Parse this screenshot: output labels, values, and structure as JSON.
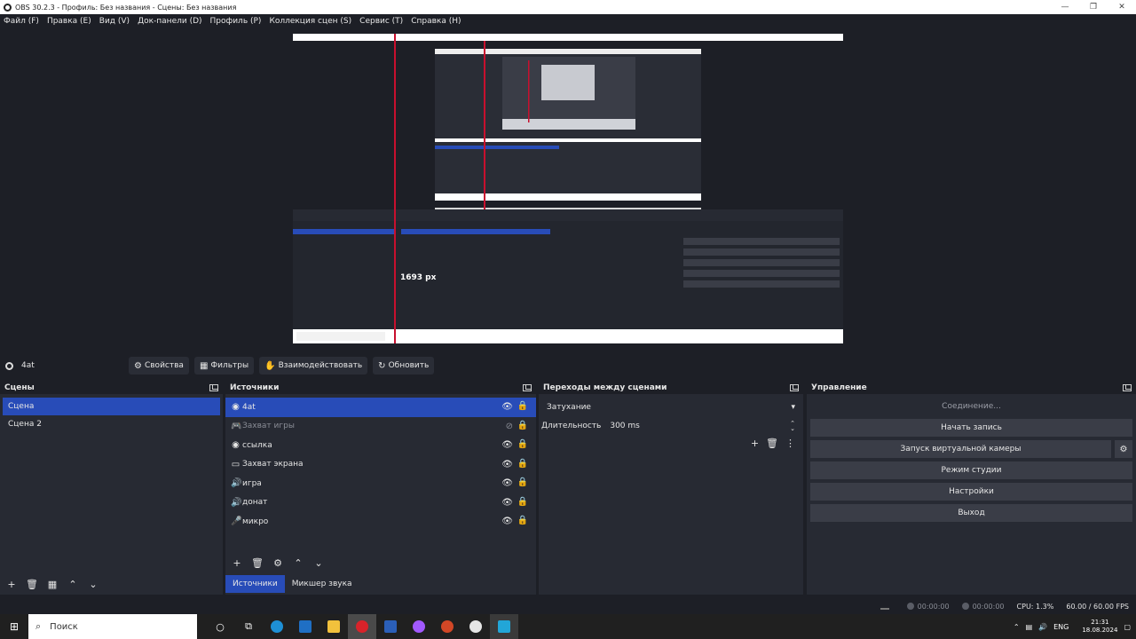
{
  "window": {
    "title": "OBS 30.2.3 - Профиль: Без названия - Сцены: Без названия"
  },
  "menu": [
    "Файл (F)",
    "Правка (E)",
    "Вид (V)",
    "Док-панели (D)",
    "Профиль (P)",
    "Коллекция сцен (S)",
    "Сервис (T)",
    "Справка (H)"
  ],
  "preview": {
    "overlay_label": "1693 px"
  },
  "source_toolbar": {
    "current_source": "4at",
    "properties": "Свойства",
    "filters": "Фильтры",
    "interact": "Взаимодействовать",
    "refresh": "Обновить"
  },
  "scenes": {
    "title": "Сцены",
    "items": [
      "Сцена",
      "Сцена 2"
    ]
  },
  "sources": {
    "title": "Источники",
    "items": [
      {
        "name": "4at",
        "icon": "browser-icon"
      },
      {
        "name": "Захват игры",
        "icon": "gamepad-icon"
      },
      {
        "name": "ссылка",
        "icon": "browser-icon"
      },
      {
        "name": "Захват экрана",
        "icon": "monitor-icon"
      },
      {
        "name": "игра",
        "icon": "speaker-icon"
      },
      {
        "name": "донат",
        "icon": "speaker-icon"
      },
      {
        "name": "микро",
        "icon": "microphone-icon"
      }
    ]
  },
  "tabs": {
    "sources": "Источники",
    "mixer": "Микшер звука"
  },
  "transitions": {
    "title": "Переходы между сценами",
    "selected": "Затухание",
    "duration_label": "Длительность",
    "duration_value": "300 ms"
  },
  "controls": {
    "title": "Управление",
    "connecting": "Соединение...",
    "start_recording": "Начать запись",
    "virtual_camera": "Запуск виртуальной камеры",
    "studio_mode": "Режим студии",
    "settings": "Настройки",
    "exit": "Выход"
  },
  "status": {
    "stream_time": "00:00:00",
    "rec_time": "00:00:00",
    "cpu": "CPU: 1.3%",
    "fps": "60.00 / 60.00 FPS"
  },
  "taskbar": {
    "search_placeholder": "Поиск",
    "lang": "ENG",
    "time": "21:31",
    "date": "18.08.2024"
  },
  "colors": {
    "accent": "#284cb8",
    "bg": "#1d1f26",
    "panel": "#272a33"
  }
}
